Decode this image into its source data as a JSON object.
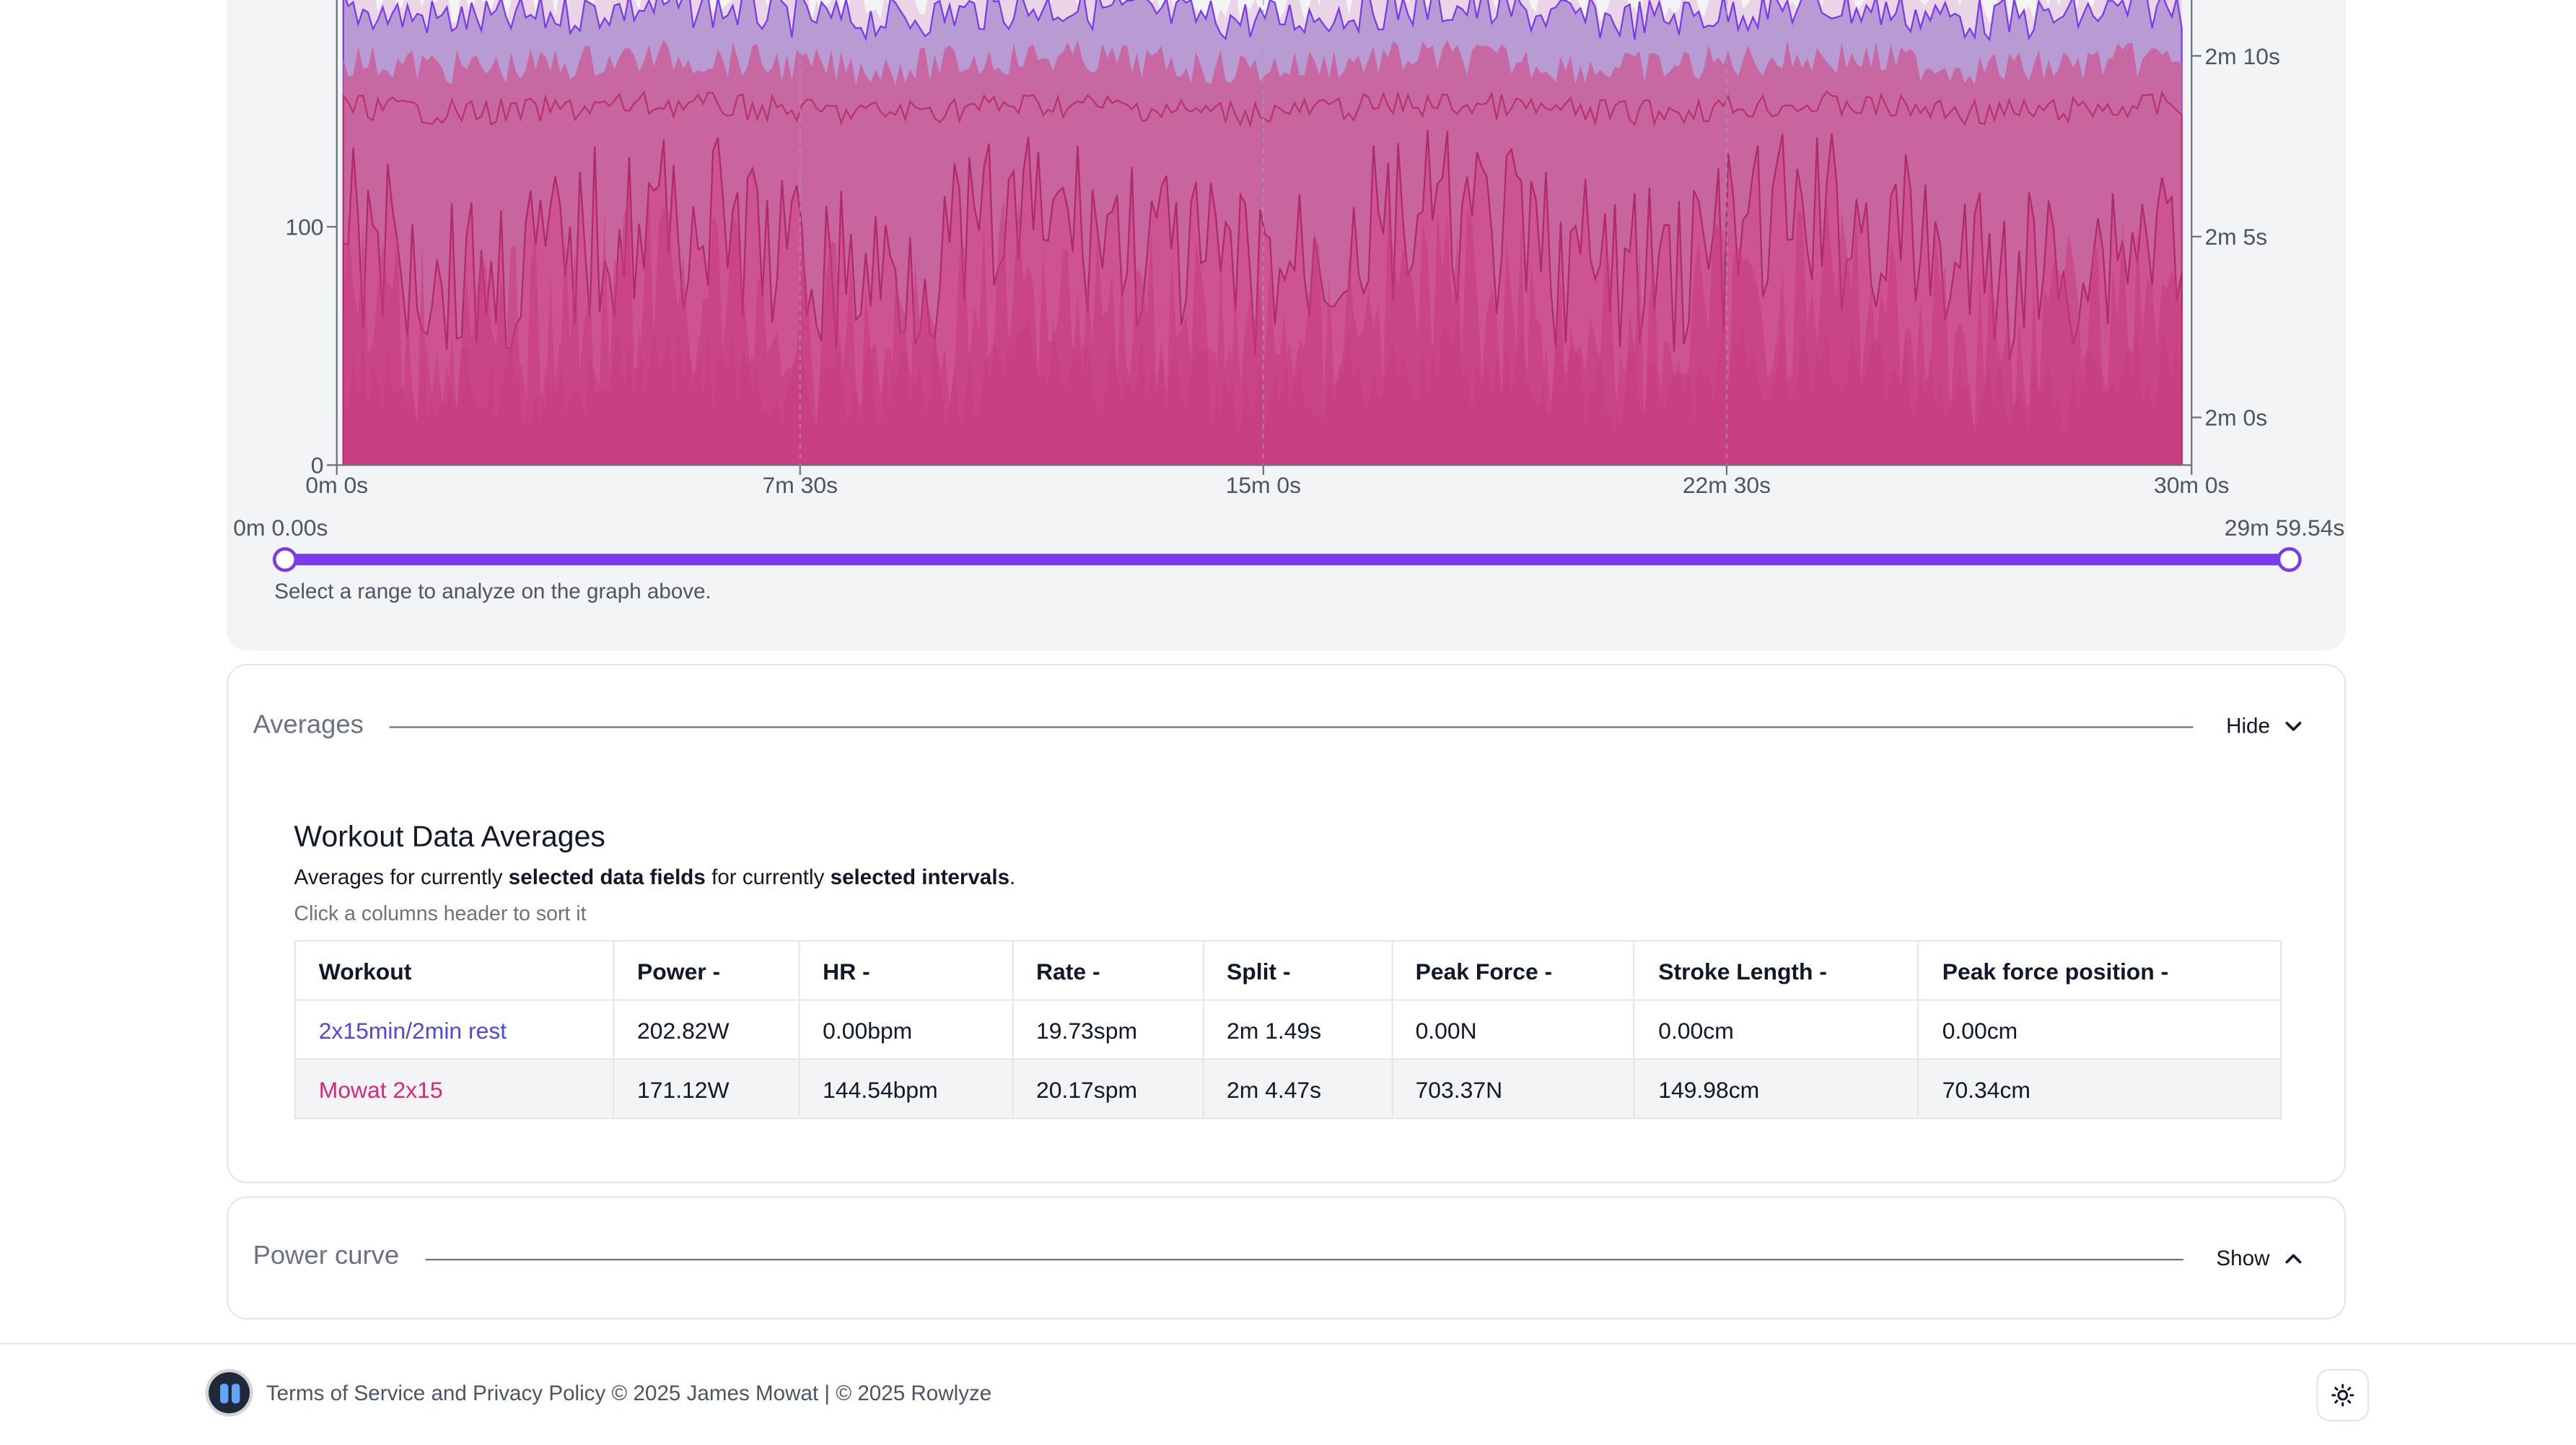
{
  "chart": {
    "left_axis_ticks": [
      "100",
      "0"
    ],
    "right_axis_ticks": [
      "2m 10s",
      "2m 5s",
      "2m 0s"
    ],
    "x_ticks": [
      "0m 0s",
      "7m 30s",
      "15m 0s",
      "22m 30s",
      "30m 0s"
    ]
  },
  "chart_data": {
    "type": "area",
    "x": [
      "0m 0s",
      "7m 30s",
      "15m 0s",
      "22m 30s",
      "30m 0s"
    ],
    "y_left_ticks": [
      0,
      100
    ],
    "y_right_ticks": [
      "2m 0s",
      "2m 5s",
      "2m 10s"
    ],
    "colors": [
      "#e9d5e6",
      "#b89bd3",
      "#c8659f",
      "#d04d8e",
      "#c63a7d",
      "#7c3aed"
    ],
    "grid": true
  },
  "range": {
    "start_label": "0m 0.00s",
    "end_label": "29m 59.54s",
    "selected_start_fraction": 0,
    "selected_end_fraction": 1,
    "help": "Select a range to analyze on the graph above."
  },
  "averages": {
    "section_title": "Averages",
    "toggle_label": "Hide",
    "heading": "Workout Data Averages",
    "desc_1": "Averages for currently ",
    "desc_2": "selected data fields",
    "desc_3": " for currently ",
    "desc_4": "selected intervals",
    "desc_5": ".",
    "hint": "Click a columns header to sort it",
    "columns": [
      "Workout",
      "Power -",
      "HR -",
      "Rate -",
      "Split -",
      "Peak Force -",
      "Stroke Length -",
      "Peak force position -"
    ],
    "rows": [
      [
        "2x15min/2min rest",
        "202.82W",
        "0.00bpm",
        "19.73spm",
        "2m 1.49s",
        "0.00N",
        "0.00cm",
        "0.00cm"
      ],
      [
        "Mowat 2x15",
        "171.12W",
        "144.54bpm",
        "20.17spm",
        "2m 4.47s",
        "703.37N",
        "149.98cm",
        "70.34cm"
      ]
    ]
  },
  "power_curve": {
    "section_title": "Power curve",
    "toggle_label": "Show"
  },
  "footer": {
    "text": "Terms of Service and Privacy Policy  © 2025 James Mowat | © 2025 Rowlyze",
    "logo_icon": "rowlyze-logo",
    "theme_icon": "sun-icon"
  }
}
